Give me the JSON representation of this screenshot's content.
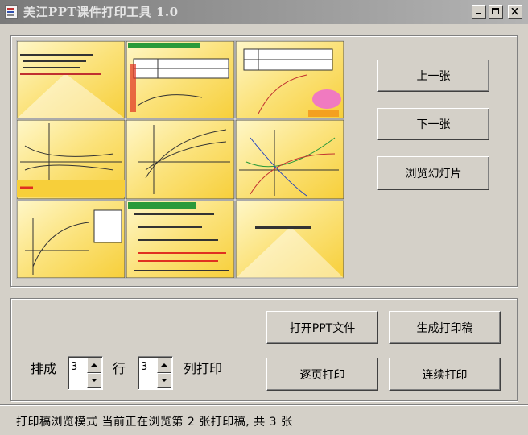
{
  "window": {
    "title": "美江PPT课件打印工具 1.0"
  },
  "nav": {
    "prev_label": "上一张",
    "next_label": "下一张",
    "browse_label": "浏览幻灯片"
  },
  "actions": {
    "open_label": "打开PPT文件",
    "generate_label": "生成打印稿",
    "page_print_label": "逐页打印",
    "continuous_print_label": "连续打印"
  },
  "layout_opts": {
    "arrange_label": "排成",
    "rows_value": "3",
    "rows_suffix": "行",
    "cols_value": "3",
    "cols_suffix": "列打印"
  },
  "status": {
    "text": "打印稿浏览模式  当前正在浏览第 2 张打印稿, 共 3 张"
  },
  "colors": {
    "slide_yellow": "#f7cf3a",
    "slide_light": "#fff7c8",
    "accent_red": "#e03020",
    "accent_blue": "#2040c0"
  }
}
